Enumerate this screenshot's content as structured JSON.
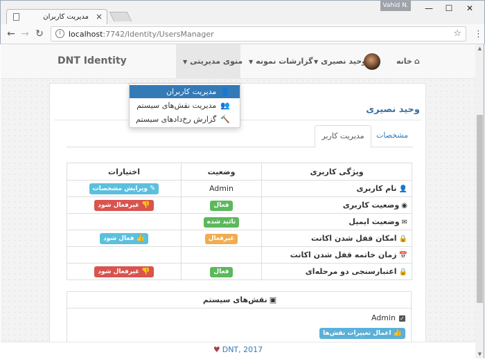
{
  "browser": {
    "tab_title": "مدیریت کاربران",
    "user_badge": "Vahid N.",
    "url": "localhost:7742/Identity/UsersManager",
    "url_host": "localhost",
    "url_rest": ":7742/Identity/UsersManager"
  },
  "navbar": {
    "brand": "DNT Identity",
    "home": "خانه",
    "user_name": "وحید نصیری",
    "reports": "گزارشات نمونه",
    "admin_menu": "منوی مدیریتی"
  },
  "dropdown": {
    "items": [
      {
        "label": "مدیریت کاربران",
        "icon": "user-icon",
        "active": true
      },
      {
        "label": "مدیریت نقش‌های سیستم",
        "icon": "users-icon",
        "active": false
      },
      {
        "label": "گزارش رخ‌دادهای سیستم",
        "icon": "gavel-icon",
        "active": false
      }
    ]
  },
  "panel": {
    "title": "وحید نصیری",
    "tabs": [
      "مشخصات",
      "مدیریت کاربر"
    ]
  },
  "table": {
    "headers": {
      "feature": "ویژگی کاربری",
      "status": "وضعیت",
      "options": "اختیارات"
    },
    "rows": [
      {
        "feature": "نام کاربری",
        "icon": "user-icon",
        "status_text": "Admin",
        "action": "ویرایش مشخصات",
        "action_color": "#5bc0de",
        "action_icon": "edit-icon"
      },
      {
        "feature": "وضعیت کاربری",
        "icon": "user-circle-icon",
        "status": "فعال",
        "status_color": "#5cb85c",
        "action": "غیرفعال شود",
        "action_color": "#d9534f",
        "action_icon": "thumbs-down-icon"
      },
      {
        "feature": "وضعیت ایمیل",
        "icon": "envelope-icon",
        "status": "تائید شده",
        "status_color": "#5cb85c"
      },
      {
        "feature": "امکان قفل شدن اکانت",
        "icon": "lock-icon",
        "status": "غیرفعال",
        "status_color": "#f0ad4e",
        "action": "فعال شود",
        "action_color": "#5bc0de",
        "action_icon": "thumbs-up-icon"
      },
      {
        "feature": "زمان خاتمه قفل شدن اکانت",
        "icon": "calendar-icon"
      },
      {
        "feature": "اعتبارسنجی دو مرحله‌ای",
        "icon": "lock-icon",
        "status": "فعال",
        "status_color": "#5cb85c",
        "action": "غیرفعال شود",
        "action_color": "#d9534f",
        "action_icon": "thumbs-down-icon"
      }
    ]
  },
  "roles": {
    "title": "نقش‌های سیستم",
    "items": [
      {
        "label": "Admin",
        "checked": true
      }
    ],
    "apply_button": "اعمال تغییرات نقش‌ها"
  },
  "footer": {
    "text": "DNT, 2017"
  }
}
